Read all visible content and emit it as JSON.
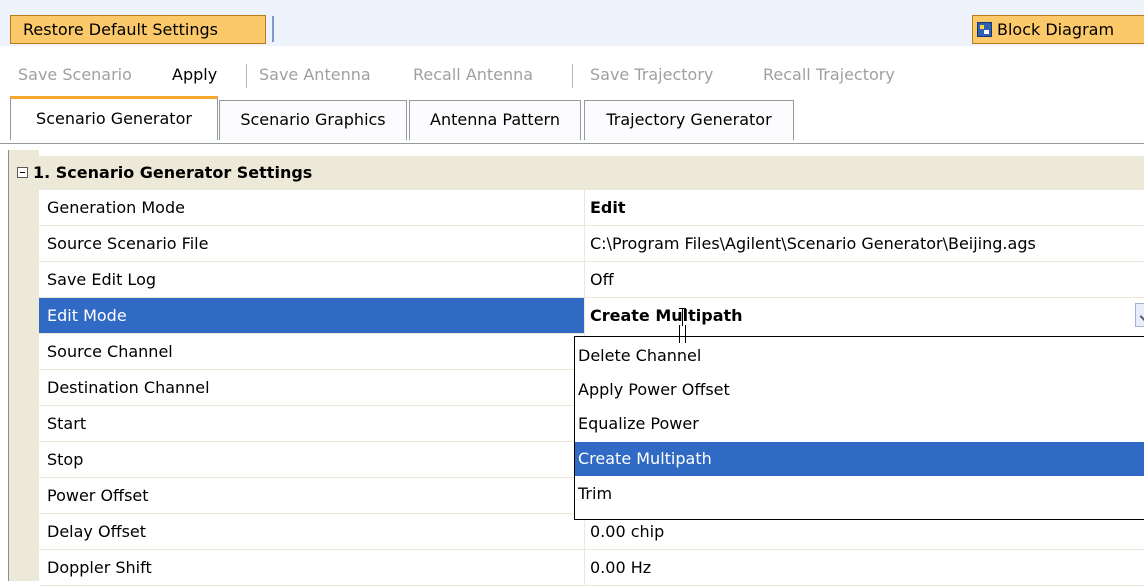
{
  "topbar": {
    "restore_label": "Restore Default Settings",
    "block_diagram_label": "Block Diagram",
    "block_diagram_icon": "block-diagram-icon"
  },
  "toolbar": {
    "save_scenario": "Save Scenario",
    "apply": "Apply",
    "save_antenna": "Save Antenna",
    "recall_antenna": "Recall Antenna",
    "save_trajectory": "Save Trajectory",
    "recall_trajectory": "Recall Trajectory"
  },
  "tabs": [
    {
      "label": "Scenario Generator",
      "selected": true
    },
    {
      "label": "Scenario Graphics"
    },
    {
      "label": "Antenna Pattern"
    },
    {
      "label": "Trajectory Generator"
    }
  ],
  "section": {
    "title": "1. Scenario Generator Settings",
    "icon": "collapse-icon"
  },
  "rows": [
    {
      "name": "Generation Mode",
      "value": "Edit"
    },
    {
      "name": "Source Scenario File",
      "value": "C:\\Program Files\\Agilent\\Scenario Generator\\Beijing.ags"
    },
    {
      "name": "Save Edit Log",
      "value": "Off"
    },
    {
      "name": "Edit Mode",
      "value": "Create Multipath"
    },
    {
      "name": "Source Channel",
      "value": ""
    },
    {
      "name": "Destination Channel",
      "value": ""
    },
    {
      "name": "Start",
      "value": ""
    },
    {
      "name": "Stop",
      "value": ""
    },
    {
      "name": "Power Offset",
      "value": ""
    },
    {
      "name": "Delay Offset",
      "value": "0.00 chip"
    },
    {
      "name": "Doppler Shift",
      "value": "0.00 Hz"
    }
  ],
  "dropdown": {
    "options": [
      "Delete Channel",
      "Apply Power Offset",
      "Equalize Power",
      "Create Multipath",
      "Trim"
    ],
    "highlighted": "Create Multipath"
  },
  "colors": {
    "selection_blue": "#316ac5",
    "button_orange": "#fbc96a",
    "tab_accent": "#f5a82b",
    "gutter": "#ece9d8"
  }
}
